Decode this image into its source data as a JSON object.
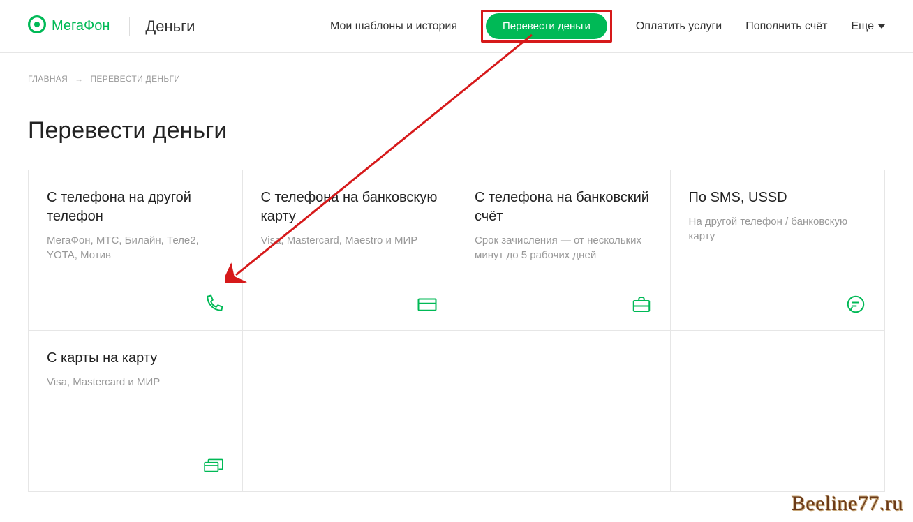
{
  "header": {
    "brand": "МегаФон",
    "section": "Деньги",
    "nav": {
      "templates": "Мои шаблоны и история",
      "transfer": "Перевести деньги",
      "pay": "Оплатить услуги",
      "topup": "Пополнить счёт",
      "more": "Еще"
    }
  },
  "breadcrumb": {
    "home": "ГЛАВНАЯ",
    "current": "ПЕРЕВЕСТИ ДЕНЬГИ"
  },
  "page_title": "Перевести деньги",
  "cards": [
    {
      "title": "С телефона на другой телефон",
      "subtitle": "МегаФон, МТС, Билайн, Теле2, YOTA, Мотив",
      "icon": "phone-icon"
    },
    {
      "title": "С телефона на банковскую карту",
      "subtitle": "Visa, Mastercard, Maestro и МИР",
      "icon": "card-icon"
    },
    {
      "title": "С телефона на банковский счёт",
      "subtitle": "Срок зачисления — от нескольких минут до 5 рабочих дней",
      "icon": "briefcase-icon"
    },
    {
      "title": "По SMS, USSD",
      "subtitle": "На другой телефон / банковскую карту",
      "icon": "chat-icon"
    },
    {
      "title": "С карты на карту",
      "subtitle": "Visa, Mastercard и МИР",
      "icon": "cards-stack-icon"
    }
  ],
  "watermark": "Beeline77.ru"
}
